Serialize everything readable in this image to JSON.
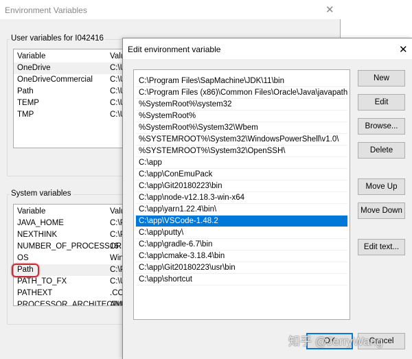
{
  "bg_window": {
    "title": "Environment Variables",
    "user_group": "User variables for I042416",
    "user_headers": [
      "Variable",
      "Value"
    ],
    "user_rows": [
      [
        "OneDrive",
        "C:\\U"
      ],
      [
        "OneDriveCommercial",
        "C:\\U"
      ],
      [
        "Path",
        "C:\\U"
      ],
      [
        "TEMP",
        "C:\\U"
      ],
      [
        "TMP",
        "C:\\U"
      ]
    ],
    "system_group": "System variables",
    "system_headers": [
      "Variable",
      "Valu"
    ],
    "system_rows": [
      [
        "JAVA_HOME",
        "C:\\P"
      ],
      [
        "NEXTHINK",
        "C:\\P"
      ],
      [
        "NUMBER_OF_PROCESSORS",
        "16"
      ],
      [
        "OS",
        "Win"
      ],
      [
        "Path",
        "C:\\P"
      ],
      [
        "PATH_TO_FX",
        "C:\\U"
      ],
      [
        "PATHEXT",
        ".CO"
      ],
      [
        "PROCESSOR_ARCHITECTU",
        "AM"
      ]
    ],
    "highlight_color": "#c0313b"
  },
  "dialog": {
    "title": "Edit environment variable",
    "paths": [
      "C:\\Program Files\\SapMachine\\JDK\\11\\bin",
      "C:\\Program Files (x86)\\Common Files\\Oracle\\Java\\javapath",
      "%SystemRoot%\\system32",
      "%SystemRoot%",
      "%SystemRoot%\\System32\\Wbem",
      "%SYSTEMROOT%\\System32\\WindowsPowerShell\\v1.0\\",
      "%SYSTEMROOT%\\System32\\OpenSSH\\",
      "C:\\app",
      "C:\\app\\ConEmuPack",
      "C:\\app\\Git20180223\\bin",
      "C:\\app\\node-v12.18.3-win-x64",
      "C:\\app\\yarn1.22.4\\bin\\",
      "C:\\app\\VSCode-1.48.2",
      "C:\\app\\putty\\",
      "C:\\app\\gradle-6.7\\bin",
      "C:\\app\\cmake-3.18.4\\bin",
      "C:\\app\\Git20180223\\usr\\bin",
      "C:\\app\\shortcut"
    ],
    "selected_index": 12,
    "buttons": {
      "new": "New",
      "edit": "Edit",
      "browse": "Browse...",
      "delete": "Delete",
      "move_up": "Move Up",
      "move_down": "Move Down",
      "edit_text": "Edit text...",
      "ok": "OK",
      "cancel": "Cancel"
    },
    "accent": "#0078d7"
  },
  "watermark": "知乎 @JerryWang"
}
